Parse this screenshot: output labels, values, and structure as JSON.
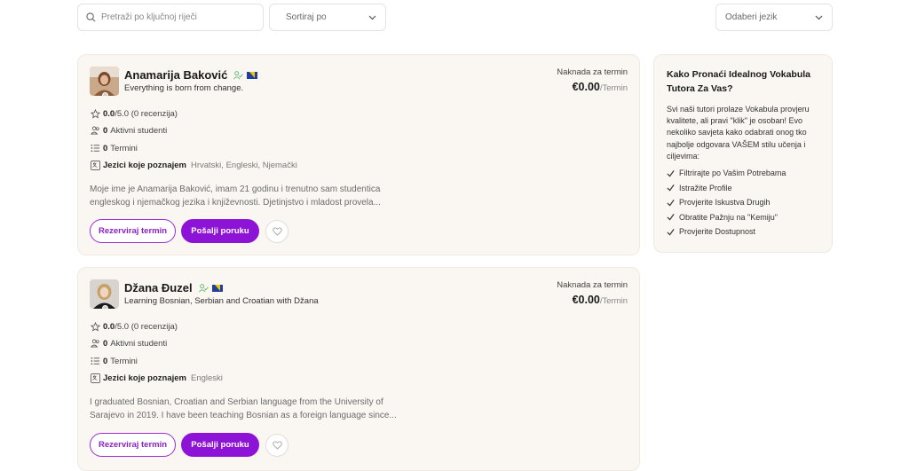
{
  "search": {
    "placeholder": "Pretraži po ključnoj riječi"
  },
  "sort": {
    "label": "Sortiraj po"
  },
  "language_filter": {
    "label": "Odaberi jezik"
  },
  "tutors": [
    {
      "name": "Anamarija Baković",
      "tagline": "Everything is born from change.",
      "rating_value": "0.0",
      "rating_rest": "/5.0 (0 recenzija)",
      "active_students": "0",
      "active_students_label": "Aktivni studenti",
      "sessions": "0",
      "sessions_label": "Termini",
      "languages_label": "Jezici koje poznajem",
      "languages": "Hrvatski, Engleski, Njemački",
      "bio_line1": "Moje ime je Anamarija Baković, imam 21 godinu i trenutno sam studentica",
      "bio_line2": "engleskog i njemačkog jezika i književnosti. Djetinjstvo i mladost provela...",
      "fee_label": "Naknada za termin",
      "price": "€0.00",
      "price_unit": "/Termin",
      "book_label": "Rezerviraj termin",
      "message_label": "Pošalji poruku"
    },
    {
      "name": "Džana Đuzel",
      "tagline": "Learning Bosnian, Serbian and Croatian with Džana",
      "rating_value": "0.0",
      "rating_rest": "/5.0 (0 recenzija)",
      "active_students": "0",
      "active_students_label": "Aktivni studenti",
      "sessions": "0",
      "sessions_label": "Termini",
      "languages_label": "Jezici koje poznajem",
      "languages": "Engleski",
      "bio_line1": "I graduated Bosnian, Croatian and Serbian language from the University of",
      "bio_line2": "Sarajevo in 2019. I have been teaching Bosnian as a foreign language since...",
      "fee_label": "Naknada za termin",
      "price": "€0.00",
      "price_unit": "/Termin",
      "book_label": "Rezerviraj termin",
      "message_label": "Pošalji poruku"
    }
  ],
  "sidebar": {
    "title": "Kako Pronaći Idealnog Vokabula Tutora Za Vas?",
    "intro": "Svi naši tutori prolaze Vokabula provjeru kvalitete, ali pravi \"klik\" je osoban! Evo nekoliko savjeta kako odabrati onog tko najbolje odgovara VAŠEM stilu učenja i ciljevima:",
    "tips": [
      "Filtrirajte po Vašim Potrebama",
      "Istražite Profile",
      "Provjerite Iskustva Drugih",
      "Obratite Pažnju na \"Kemiju\"",
      "Provjerite Dostupnost"
    ]
  },
  "colors": {
    "accent": "#8d14d6",
    "card_bg": "#faf6f1",
    "verified_green": "#5bb56a"
  }
}
